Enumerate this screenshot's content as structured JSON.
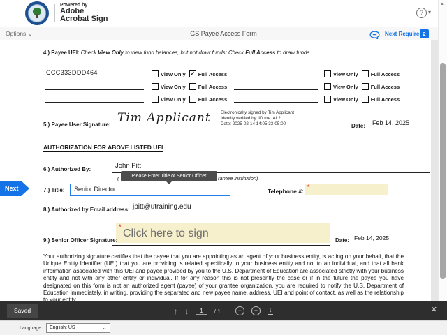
{
  "header": {
    "powered_by": "Powered by",
    "brand_name": "Adobe",
    "brand_product": "Acrobat Sign"
  },
  "toolbar": {
    "options": "Options",
    "title": "GS Payee Access Form",
    "next_required": "Next Required",
    "next_required_count": "2"
  },
  "icons": {
    "help": "?",
    "caret_down": "▾",
    "chevron_down": "⌄",
    "scroll_up": "▲",
    "arrow_up": "↑",
    "arrow_down": "↓",
    "zoom_out": "−",
    "zoom_in": "+",
    "download": "↓",
    "close": "✕"
  },
  "doc": {
    "labels": {
      "view_only": "View Only",
      "full_access": "Full Access"
    },
    "item4": {
      "number": "4.)",
      "label": "Payee UEI:",
      "instr_1": "Check ",
      "instr_bold_1": "View Only",
      "instr_2": " to view fund balances, but not draw funds; Check ",
      "instr_bold_2": "Full Access",
      "instr_3": " to draw funds."
    },
    "uei": {
      "left": [
        {
          "value": "CCC333DDD464",
          "vo": "",
          "fa": "✓"
        },
        {
          "value": "",
          "vo": "",
          "fa": ""
        },
        {
          "value": "",
          "vo": "",
          "fa": ""
        }
      ],
      "right": [
        {
          "value": "",
          "vo": "",
          "fa": ""
        },
        {
          "value": "",
          "vo": "",
          "fa": ""
        },
        {
          "value": "",
          "vo": "",
          "fa": ""
        }
      ]
    },
    "item5": {
      "label": "5.)  Payee User Signature:",
      "signature": "Tim Applicant",
      "stamp_1": "Electronically signed by Tim Applicant",
      "stamp_2": "Identity verified by: ID.me IAL2",
      "stamp_3": "Date: 2025-02-14 14:05:33-05:00",
      "date_label": "Date:",
      "date_value": "Feb 14, 2025"
    },
    "heading": "AUTHORIZATION FOR ABOVE LISTED UEI",
    "item6": {
      "label": "6.)  Authorized By:",
      "value": "John Pitt",
      "caption_open": "(",
      "caption_end": "rantee institution)"
    },
    "tooltip": "Please Enter Title of Senior Officer",
    "next_tab": "Next",
    "item7": {
      "label": "7.)  Title:",
      "value": "Senior Director",
      "phone_label": "Telephone #:",
      "asterisk": "*"
    },
    "item8": {
      "label": "8.)  Authorized by Email address:",
      "value": "jpitt@utraining.edu"
    },
    "item9": {
      "label": "9.)  Senior Officer Signature:",
      "asterisk": "*",
      "placeholder": "Click here to sign",
      "date_label": "Date:",
      "date_value": "Feb 14, 2025"
    },
    "legal": "Your authorizing signature certifies that the payee that you are appointing as an agent of your business entity, is acting on your behalf, that the Unique Entity Identifier (UEI) that you are providing is related specifically to your business entity and not to an individual, and that all bank information associated with this UEI and payee provided by you to the U.S. Department of Education are associated strictly with your business entity and not with any other entity or individual. If for any reason this is not presently the case or if in the future the payee you have designated on this form is not an authorized agent (payee) of your grantee organization, you are required to notify the U.S. Department of Education immediately, in writing, providing the separated and new payee name, address, UEI and point of contact, as well as the relationship to your entity."
  },
  "statusbar": {
    "saved": "Saved",
    "page_current": "1",
    "page_total": "/ 1"
  },
  "footer": {
    "language_label": "Language:",
    "language_value": "English: US"
  },
  "colors": {
    "accent": "#1473E6",
    "required_field_bg": "#F7F0CD",
    "asterisk": "#E34850",
    "tooltip_bg": "#4D4D4D"
  }
}
